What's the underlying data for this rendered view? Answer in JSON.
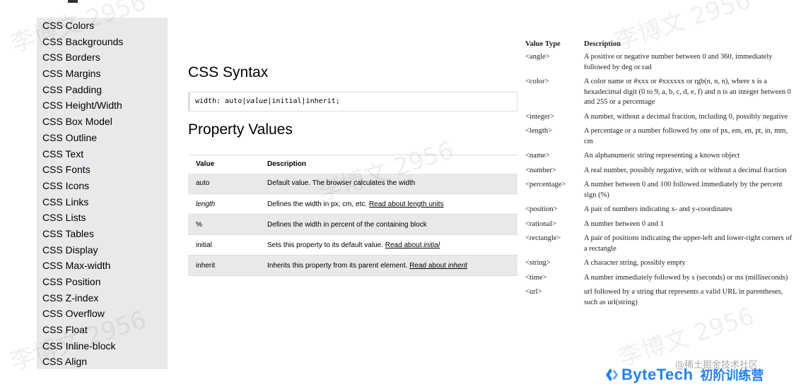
{
  "sidebar": {
    "items": [
      "CSS Colors",
      "CSS Backgrounds",
      "CSS Borders",
      "CSS Margins",
      "CSS Padding",
      "CSS Height/Width",
      "CSS Box Model",
      "CSS Outline",
      "CSS Text",
      "CSS Fonts",
      "CSS Icons",
      "CSS Links",
      "CSS Lists",
      "CSS Tables",
      "CSS Display",
      "CSS Max-width",
      "CSS Position",
      "CSS Z-index",
      "CSS Overflow",
      "CSS Float",
      "CSS Inline-block",
      "CSS Align"
    ]
  },
  "syntax": {
    "title": "CSS Syntax",
    "code_prefix": "width: auto|",
    "code_italic": "value",
    "code_suffix": "|initial|inherit;"
  },
  "properties": {
    "title": "Property Values",
    "header_value": "Value",
    "header_description": "Description",
    "rows": [
      {
        "value": "auto",
        "desc": "Default value. The browser calculates the width",
        "link": "",
        "link_italic": ""
      },
      {
        "value": "length",
        "desc": "Defines the width in px, cm, etc. ",
        "link": "Read about length units",
        "link_italic": ""
      },
      {
        "value": "%",
        "desc": "Defines the width in percent of the containing block",
        "link": "",
        "link_italic": ""
      },
      {
        "value": "initial",
        "desc": "Sets this property to its default value. ",
        "link": "Read about ",
        "link_italic": "initial"
      },
      {
        "value": "inherit",
        "desc": "Inherits this property from its parent element. ",
        "link": "Read about ",
        "link_italic": "inherit"
      }
    ]
  },
  "value_types": {
    "header_type": "Value Type",
    "header_description": "Description",
    "rows": [
      {
        "type": "<angle>",
        "desc": "A positive or negative number between 0 and 360, immediately followed by deg or rad"
      },
      {
        "type": "<color>",
        "desc": "A color name or #xxx or #xxxxxx or rgb(n, n, n), where x is a hexadecimal digit (0 to 9, a, b, c, d, e, f) and n is an integer between 0 and 255 or a percentage"
      },
      {
        "type": "<integer>",
        "desc": "A number, without a decimal fraction, including 0, possibly negative"
      },
      {
        "type": "<length>",
        "desc": "A percentage or a number followed by one of px, em, en, pt, in, mm, cm"
      },
      {
        "type": "<name>",
        "desc": "An alphanumeric string representing a known object"
      },
      {
        "type": "<number>",
        "desc": "A real number, possibly negative, with or without a decimal fraction"
      },
      {
        "type": "<percentage>",
        "desc": "A number between 0 and 100 followed immediately by the percent sign (%)"
      },
      {
        "type": "<position>",
        "desc": "A pair of numbers indicating x- and y-coordinates"
      },
      {
        "type": "<rational>",
        "desc": "A number between 0 and 1"
      },
      {
        "type": "<rectangle>",
        "desc": "A pair of positions indicating the upper-left and lower-right corners of a rectangle"
      },
      {
        "type": "<string>",
        "desc": "A character string, possibly empty"
      },
      {
        "type": "<time>",
        "desc": "A number immediately followed by s (seconds) or ms (milliseconds)"
      },
      {
        "type": "<url>",
        "desc": "url followed by a string that represents a valid URL in parentheses, such as url(string)"
      }
    ]
  },
  "watermark": {
    "text": "李博文 2956"
  },
  "footer": {
    "source": "@稀土掘金技术社区",
    "brand": "ByteTech",
    "brand_sub": "初阶训练营",
    "brand_color": "#1e80ff"
  }
}
